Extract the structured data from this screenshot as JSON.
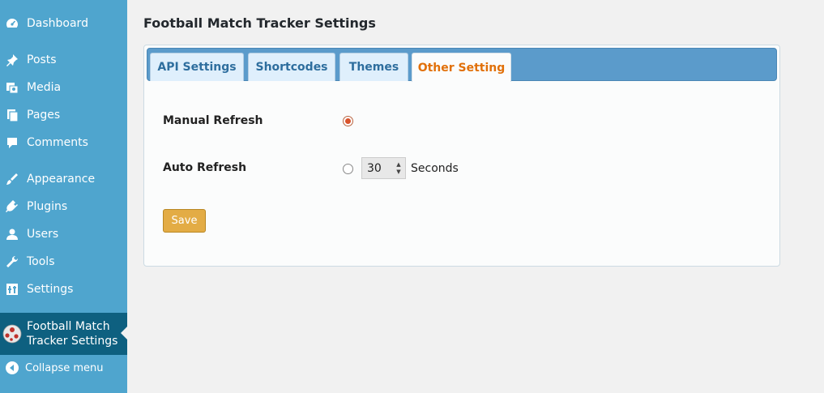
{
  "sidebar": {
    "items": [
      {
        "label": "Dashboard",
        "icon": "dashboard-icon"
      },
      {
        "label": "Posts",
        "icon": "pin-icon"
      },
      {
        "label": "Media",
        "icon": "media-icon"
      },
      {
        "label": "Pages",
        "icon": "pages-icon"
      },
      {
        "label": "Comments",
        "icon": "comments-icon"
      },
      {
        "label": "Appearance",
        "icon": "paintbrush-icon"
      },
      {
        "label": "Plugins",
        "icon": "plugin-icon"
      },
      {
        "label": "Users",
        "icon": "user-icon"
      },
      {
        "label": "Tools",
        "icon": "wrench-icon"
      },
      {
        "label": "Settings",
        "icon": "settings-icon"
      }
    ],
    "active": {
      "label": "Football Match Tracker Settings",
      "icon": "football-icon"
    },
    "collapse": {
      "label": "Collapse menu",
      "icon": "collapse-arrow-icon"
    }
  },
  "main": {
    "title": "Football Match Tracker Settings",
    "tabs": [
      {
        "label": "API Settings"
      },
      {
        "label": "Shortcodes"
      },
      {
        "label": "Themes"
      },
      {
        "label": "Other Setting",
        "active": true
      }
    ],
    "manual_refresh": {
      "label": "Manual Refresh",
      "checked": true
    },
    "auto_refresh": {
      "label": "Auto Refresh",
      "checked": false,
      "value": "30",
      "unit": "Seconds"
    },
    "save_label": "Save"
  },
  "colors": {
    "sidebar_bg": "#4fa5ce",
    "active_menu_bg": "#0e6080",
    "tab_bar_bg": "#5b9bcb",
    "active_tab_text": "#e17009",
    "save_button_bg": "#e3ac45"
  }
}
